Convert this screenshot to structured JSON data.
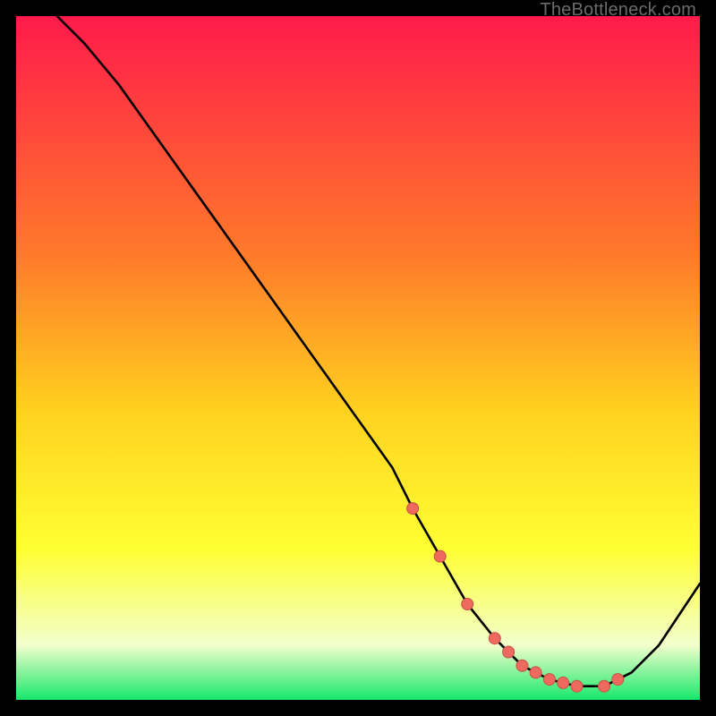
{
  "watermark": "TheBottleneck.com",
  "colors": {
    "gradient_top": "#ff1a4b",
    "gradient_mid1": "#ff7a2a",
    "gradient_mid2": "#ffd21f",
    "gradient_mid3": "#ffff33",
    "gradient_low": "#f2ffcc",
    "gradient_bottom": "#17e86b",
    "curve": "#000000",
    "marker_fill": "#ee6a5f",
    "marker_stroke": "#c94f44"
  },
  "chart_data": {
    "type": "line",
    "title": "",
    "xlabel": "",
    "ylabel": "",
    "xlim": [
      0,
      100
    ],
    "ylim": [
      0,
      100
    ],
    "grid": false,
    "legend": false,
    "series": [
      {
        "name": "bottleneck-curve",
        "x": [
          6,
          10,
          15,
          20,
          25,
          30,
          35,
          40,
          45,
          50,
          55,
          58,
          62,
          66,
          70,
          74,
          78,
          82,
          86,
          90,
          94,
          100
        ],
        "y": [
          100,
          96,
          90,
          83,
          76,
          69,
          62,
          55,
          48,
          41,
          34,
          28,
          21,
          14,
          9,
          5,
          3,
          2,
          2,
          4,
          8,
          17
        ]
      }
    ],
    "markers": {
      "name": "highlight-points",
      "x": [
        58,
        62,
        66,
        70,
        72,
        74,
        76,
        78,
        80,
        82,
        86,
        88
      ],
      "y": [
        28,
        21,
        14,
        9,
        7,
        5,
        4,
        3,
        2.5,
        2,
        2,
        3
      ]
    }
  }
}
